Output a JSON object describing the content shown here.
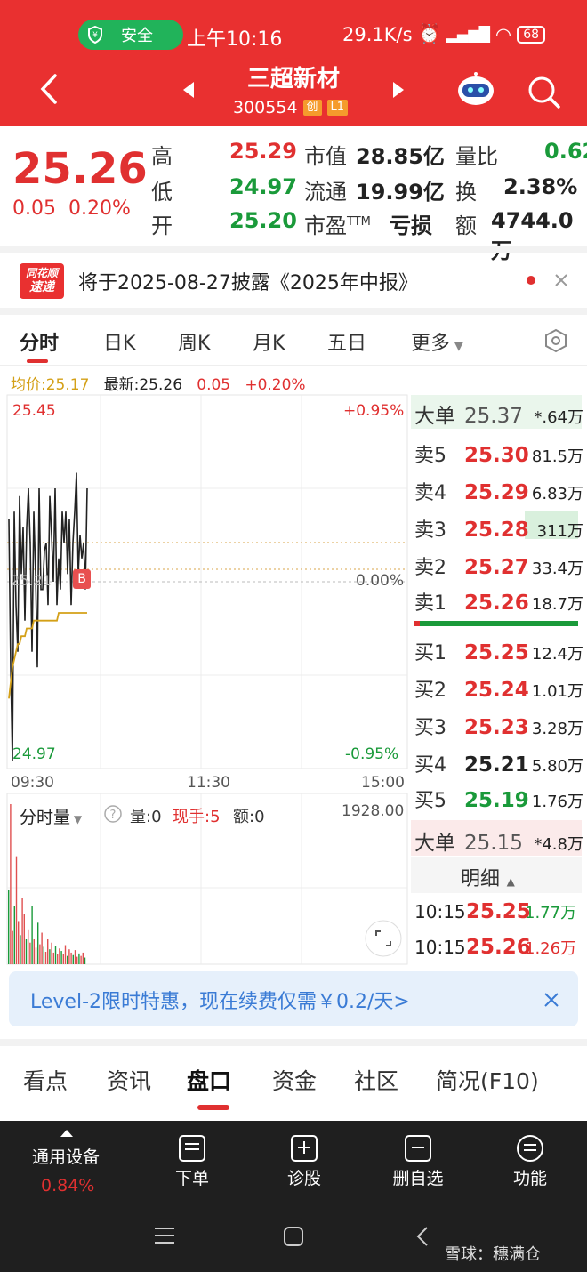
{
  "status_bar": {
    "safe_label": "安全",
    "time": "上午10:16",
    "net_speed": "29.1K/s",
    "battery": "68"
  },
  "header": {
    "title": "三超新材",
    "code": "300554",
    "tag1": "创",
    "tag2": "L1"
  },
  "quote": {
    "price": "25.26",
    "change": "0.05",
    "change_pct": "0.20%",
    "high_label": "高",
    "high": "25.29",
    "low_label": "低",
    "low": "24.97",
    "open_label": "开",
    "open": "25.20",
    "mcap_label": "市值",
    "mcap": "28.85亿",
    "float_label": "流通",
    "float": "19.99亿",
    "pe_label": "市盈",
    "pe_suffix": "TTM",
    "pe": "亏损",
    "vr_label": "量比",
    "vr": "0.62",
    "turn_label": "换",
    "turn": "2.38%",
    "amt_label": "额",
    "amt": "4744.0万"
  },
  "notice": {
    "logo_line1": "同花顺",
    "logo_line2": "速递",
    "text": "将于2025-08-27披露《2025年中报》"
  },
  "chart_tabs": [
    "分时",
    "日K",
    "周K",
    "月K",
    "五日",
    "更多"
  ],
  "chart_info": {
    "avg": "均价:25.17",
    "latest": "最新:25.26",
    "chg": "0.05",
    "pct": "+0.20%"
  },
  "chart_data": {
    "type": "line",
    "ylim": [
      24.97,
      25.45
    ],
    "y_left_top": "25.45",
    "y_left_bottom": "24.97",
    "y_right_top": "+0.95%",
    "y_right_mid": "0.00%",
    "y_right_bottom": "-0.95%",
    "prev_close_label": "25.21",
    "x_ticks": [
      "09:30",
      "11:30",
      "15:00"
    ],
    "buy_marker": "B",
    "series": [
      {
        "name": "最新",
        "values": [
          25.29,
          25.1,
          24.98,
          25.3,
          25.18,
          25.12,
          25.32,
          25.22,
          25.28,
          25.16,
          25.28,
          25.33,
          25.26,
          25.12,
          25.3,
          25.22,
          25.1,
          25.33,
          25.2,
          25.2,
          25.25,
          25.26,
          25.18,
          25.32,
          25.27,
          25.21,
          25.33,
          25.18,
          25.24,
          25.2,
          25.3,
          25.26,
          25.3,
          25.22,
          25.29,
          25.18,
          25.26,
          25.3,
          25.35,
          25.22,
          25.27,
          25.24,
          25.26,
          25.2,
          25.33
        ]
      },
      {
        "name": "均价",
        "values": [
          25.06,
          25.08,
          25.1,
          25.11,
          25.12,
          25.13,
          25.13,
          25.14,
          25.14,
          25.14,
          25.15,
          25.15,
          25.15,
          25.15,
          25.16,
          25.16,
          25.16,
          25.16,
          25.16,
          25.16,
          25.16,
          25.16,
          25.16,
          25.16,
          25.16,
          25.16,
          25.16,
          25.16,
          25.17,
          25.17,
          25.17,
          25.17,
          25.17,
          25.17,
          25.17,
          25.17,
          25.17,
          25.17,
          25.17,
          25.17,
          25.17,
          25.17,
          25.17,
          25.17,
          25.17
        ]
      }
    ]
  },
  "volume": {
    "selector": "分时量",
    "vol": "量:0",
    "hand": "现手:5",
    "amt": "额:0",
    "max": "1928.00",
    "bars": [
      900,
      1928,
      400,
      700,
      1300,
      520,
      350,
      800,
      600,
      300,
      420,
      260,
      700,
      300,
      200,
      500,
      240,
      380,
      210,
      150,
      300,
      180,
      260,
      140,
      220,
      120,
      190,
      160,
      120,
      230,
      100,
      180,
      140,
      110,
      170,
      90,
      130,
      100,
      140,
      80
    ]
  },
  "order_book": {
    "big_sell_label": "大单",
    "big_sell_price": "25.37",
    "big_sell_vol": "*.64万",
    "asks": [
      {
        "label": "卖5",
        "price": "25.30",
        "vol": "81.5万"
      },
      {
        "label": "卖4",
        "price": "25.29",
        "vol": "6.83万"
      },
      {
        "label": "卖3",
        "price": "25.28",
        "vol": "311万"
      },
      {
        "label": "卖2",
        "price": "25.27",
        "vol": "33.4万"
      },
      {
        "label": "卖1",
        "price": "25.26",
        "vol": "18.7万"
      }
    ],
    "bids": [
      {
        "label": "买1",
        "price": "25.25",
        "vol": "12.4万"
      },
      {
        "label": "买2",
        "price": "25.24",
        "vol": "1.01万"
      },
      {
        "label": "买3",
        "price": "25.23",
        "vol": "3.28万"
      },
      {
        "label": "买4",
        "price": "25.21",
        "vol": "5.80万"
      },
      {
        "label": "买5",
        "price": "25.19",
        "vol": "1.76万"
      }
    ],
    "big_buy_label": "大单",
    "big_buy_price": "25.15",
    "big_buy_vol": "*4.8万",
    "detail_label": "明细",
    "ticks": [
      {
        "time": "10:15",
        "price": "25.25",
        "vol": "1.77万"
      },
      {
        "time": "10:15",
        "price": "25.26",
        "vol": "1.26万"
      }
    ]
  },
  "level2_banner": "Level-2限时特惠，现在续费仅需￥0.2/天>",
  "bottom_tabs": [
    "看点",
    "资讯",
    "盘口",
    "资金",
    "社区",
    "简况(F10)"
  ],
  "dock": {
    "device_label": "通用设备",
    "device_pct": "0.84%",
    "items": [
      "下单",
      "诊股",
      "删自选",
      "功能"
    ]
  },
  "watermark": "雪球：穗满仓"
}
